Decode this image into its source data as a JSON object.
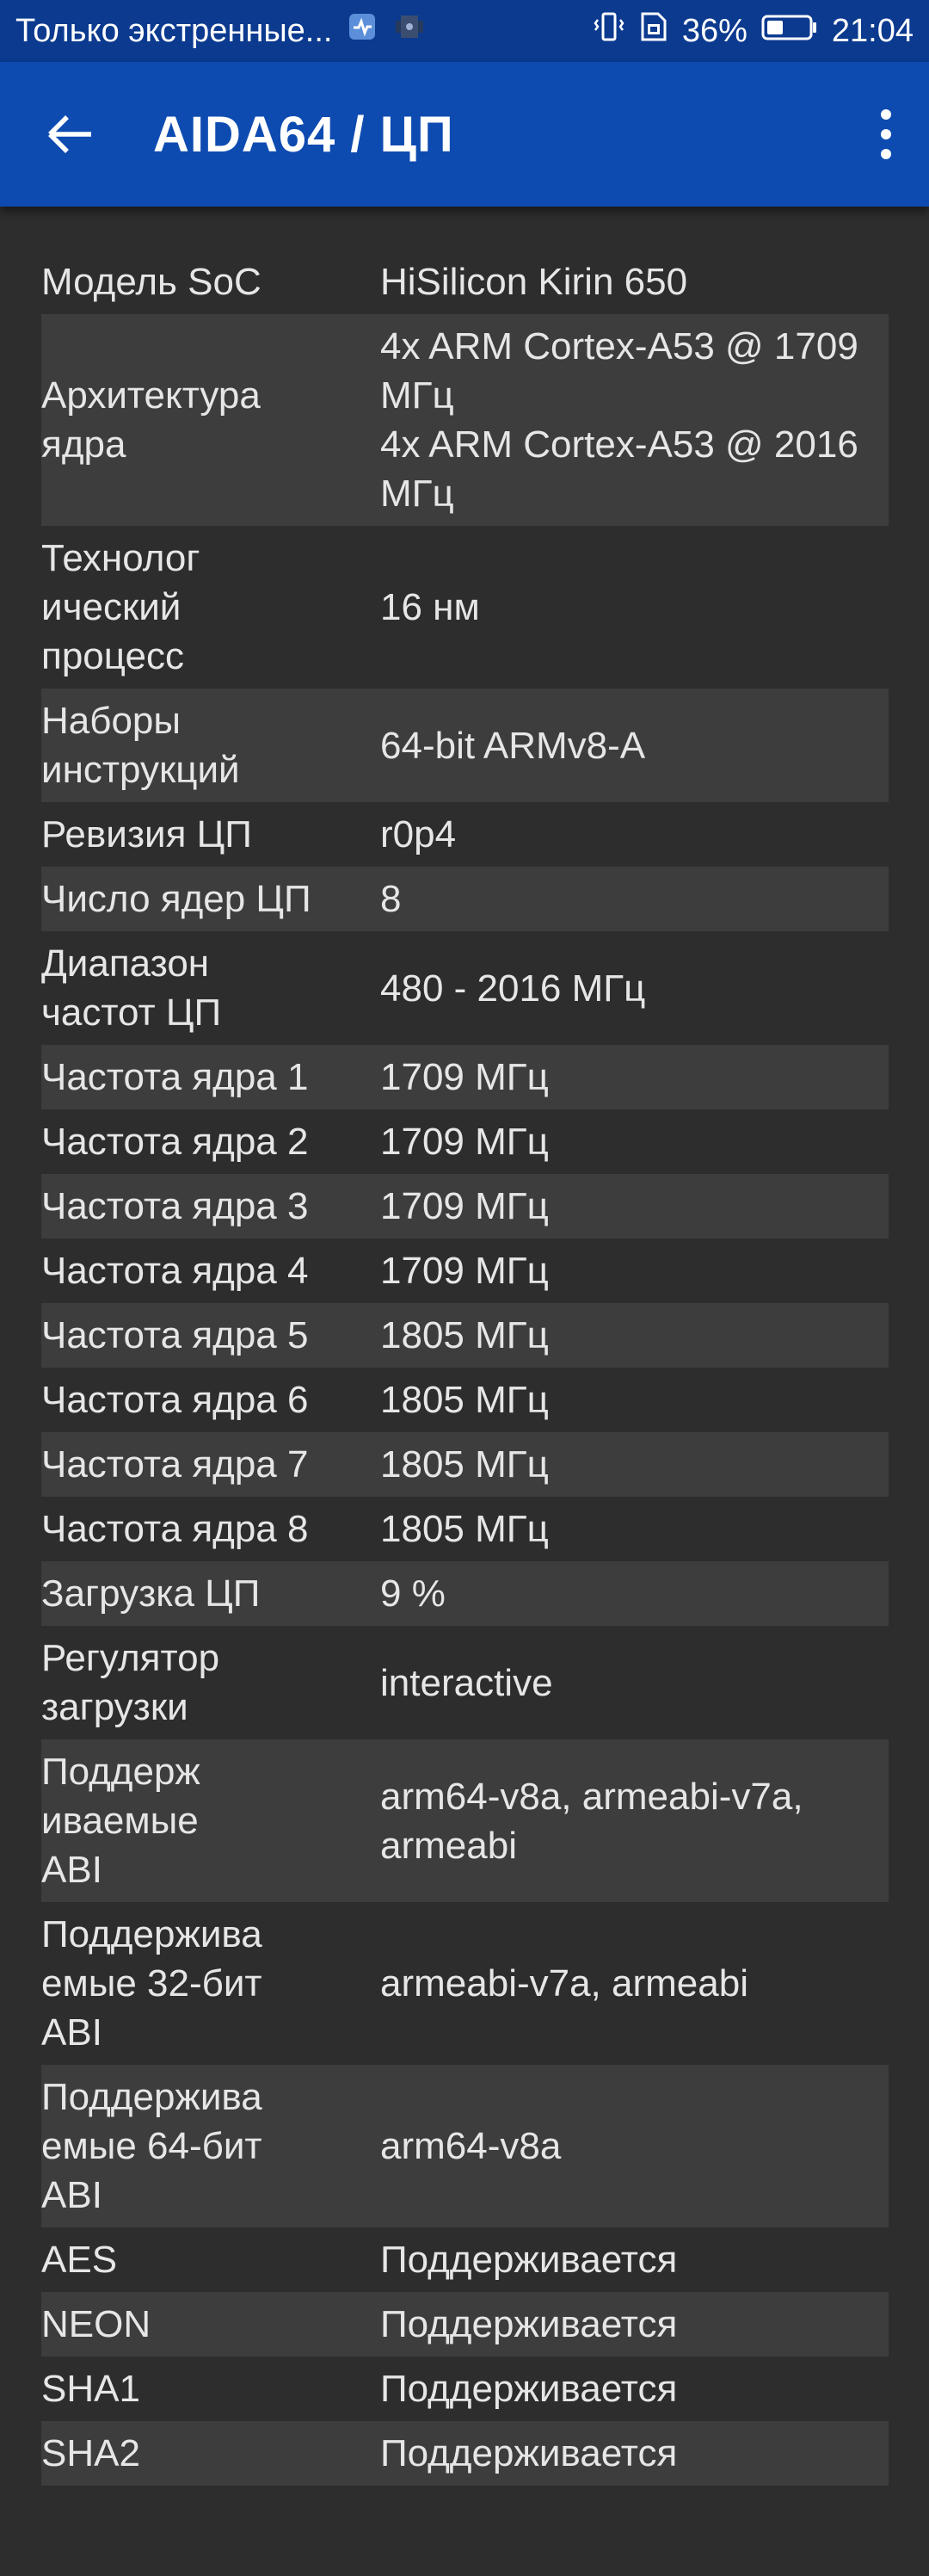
{
  "status_bar": {
    "notification_text": "Только экстренные...",
    "battery_percent": "36%",
    "time": "21:04"
  },
  "app_bar": {
    "title": "AIDA64  /  ЦП"
  },
  "rows": [
    {
      "label": "Модель SoC",
      "value": "HiSilicon Kirin 650"
    },
    {
      "label": "Архитектура\nядра",
      "value": "4x ARM Cortex-A53 @ 1709\nМГц\n4x ARM Cortex-A53 @ 2016\nМГц"
    },
    {
      "label": "Технолог\nический\nпроцесс",
      "value": "16 нм"
    },
    {
      "label": "Наборы\nинструкций",
      "value": "64-bit ARMv8-A"
    },
    {
      "label": "Ревизия ЦП",
      "value": "r0p4"
    },
    {
      "label": "Число ядер ЦП",
      "value": "8"
    },
    {
      "label": "Диапазон\nчастот ЦП",
      "value": "480 - 2016 МГц"
    },
    {
      "label": "Частота ядра 1",
      "value": "1709 МГц"
    },
    {
      "label": "Частота ядра 2",
      "value": "1709 МГц"
    },
    {
      "label": "Частота ядра 3",
      "value": "1709 МГц"
    },
    {
      "label": "Частота ядра 4",
      "value": "1709 МГц"
    },
    {
      "label": "Частота ядра 5",
      "value": "1805 МГц"
    },
    {
      "label": "Частота ядра 6",
      "value": "1805 МГц"
    },
    {
      "label": "Частота ядра 7",
      "value": "1805 МГц"
    },
    {
      "label": "Частота ядра 8",
      "value": "1805 МГц"
    },
    {
      "label": "Загрузка ЦП",
      "value": "9 %"
    },
    {
      "label": "Регулятор\nзагрузки",
      "value": "interactive"
    },
    {
      "label": "Поддерж\nиваемые\nABI",
      "value": "arm64-v8a, armeabi-v7a,\narmeabi"
    },
    {
      "label": "Поддержива\nемые 32-бит\nABI",
      "value": "armeabi-v7a, armeabi"
    },
    {
      "label": "Поддержива\nемые 64-бит\nABI",
      "value": "arm64-v8a"
    },
    {
      "label": "AES",
      "value": "Поддерживается"
    },
    {
      "label": "NEON",
      "value": "Поддерживается"
    },
    {
      "label": "SHA1",
      "value": "Поддерживается"
    },
    {
      "label": "SHA2",
      "value": "Поддерживается"
    }
  ]
}
